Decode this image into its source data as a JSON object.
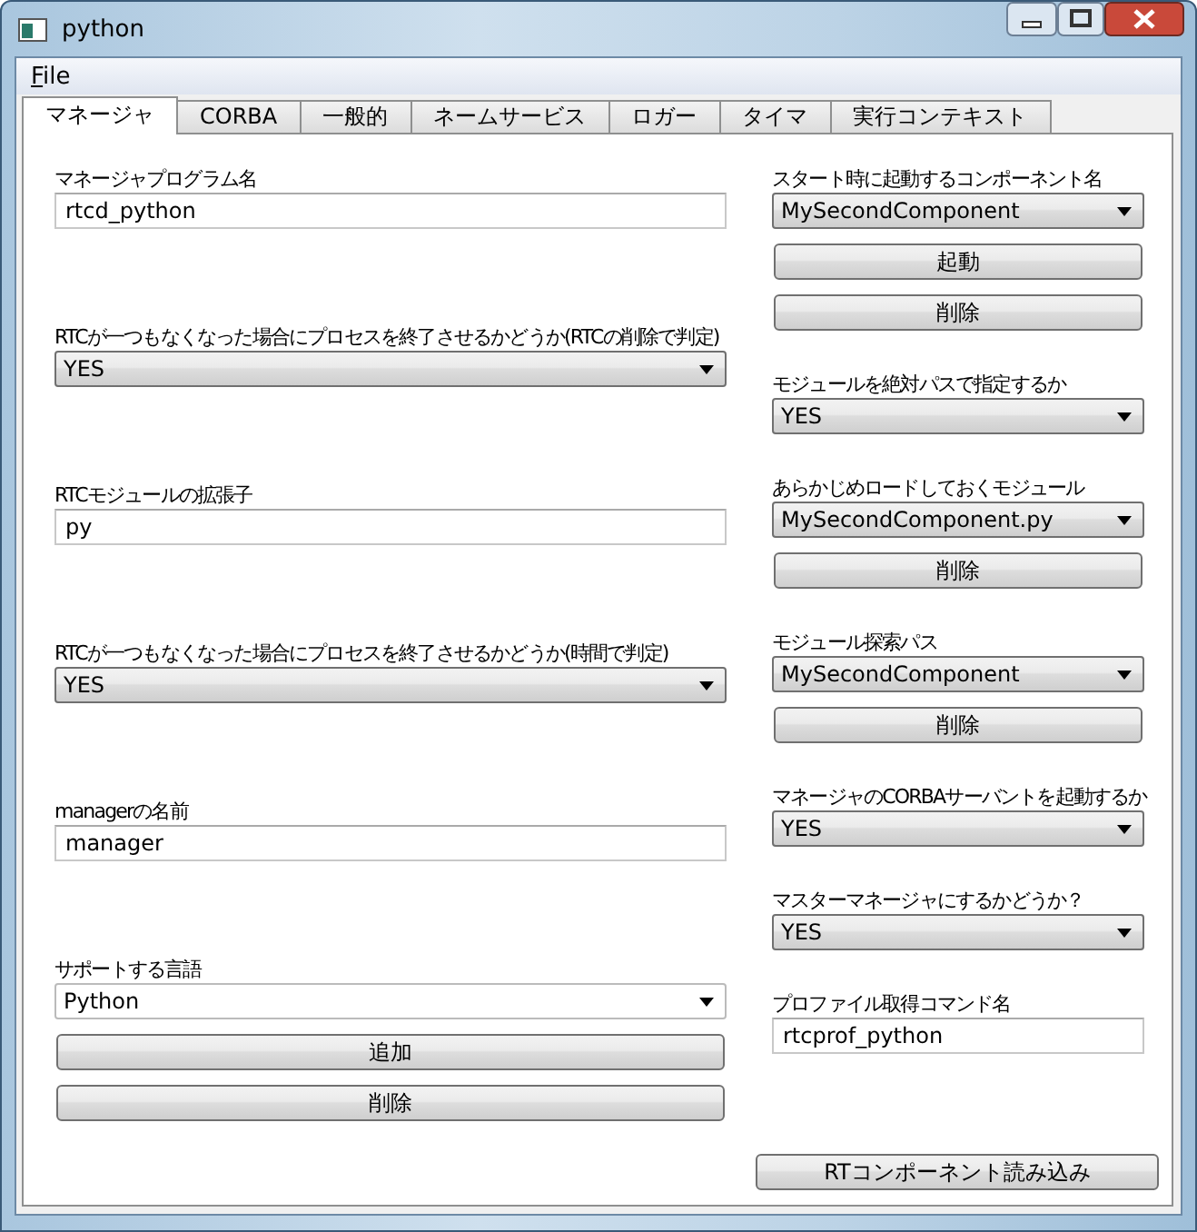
{
  "window": {
    "title": "python"
  },
  "menu": [
    {
      "label": "File"
    }
  ],
  "tabs": [
    {
      "label": "マネージャ",
      "selected": true
    },
    {
      "label": "CORBA",
      "selected": false
    },
    {
      "label": "一般的",
      "selected": false
    },
    {
      "label": "ネームサービス",
      "selected": false
    },
    {
      "label": "ロガー",
      "selected": false
    },
    {
      "label": "タイマ",
      "selected": false
    },
    {
      "label": "実行コンテキスト",
      "selected": false
    }
  ],
  "left_column": [
    {
      "label": "マネージャプログラム名",
      "kind": "text",
      "value": "rtcd_python"
    },
    {
      "label": "RTCが一つもなくなった場合にプロセスを終了させるかどうか(RTCの削除で判定)",
      "kind": "combo",
      "value": "YES"
    },
    {
      "label": "RTCモジュールの拡張子",
      "kind": "text",
      "value": "py"
    },
    {
      "label": "RTCが一つもなくなった場合にプロセスを終了させるかどうか(時間で判定)",
      "kind": "combo",
      "value": "YES"
    },
    {
      "label": "managerの名前",
      "kind": "text",
      "value": "manager"
    },
    {
      "label": "サポートする言語",
      "kind": "editable_combo",
      "value": "Python",
      "buttons": [
        "追加",
        "削除"
      ]
    }
  ],
  "right_column": [
    {
      "label": "スタート時に起動するコンポーネント名",
      "kind": "combo",
      "value": "MySecondComponent",
      "buttons": [
        "起動",
        "削除"
      ]
    },
    {
      "label": "モジュールを絶対パスで指定するか",
      "kind": "combo",
      "value": "YES"
    },
    {
      "label": "あらかじめロードしておくモジュール",
      "kind": "combo",
      "value": "MySecondComponent.py",
      "buttons": [
        "削除"
      ]
    },
    {
      "label": "モジュール探索パス",
      "kind": "combo",
      "value": "MySecondComponent",
      "buttons": [
        "削除"
      ]
    },
    {
      "label": "マネージャのCORBAサーバントを起動するか",
      "kind": "combo",
      "value": "YES"
    },
    {
      "label": "マスターマネージャにするかどうか？",
      "kind": "combo",
      "value": "YES"
    },
    {
      "label": "プロファイル取得コマンド名",
      "kind": "text",
      "value": "rtcprof_python"
    }
  ],
  "footer_button": "RTコンポーネント読み込み"
}
